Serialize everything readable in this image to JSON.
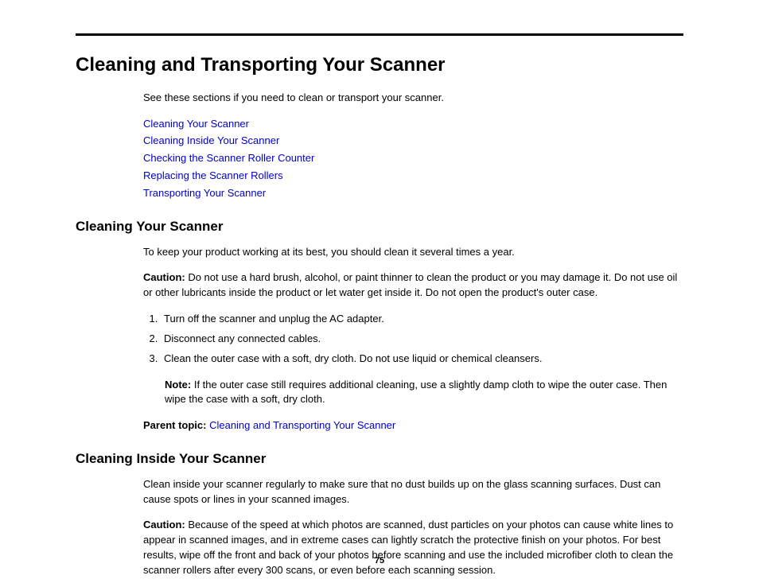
{
  "heading": "Cleaning and Transporting Your Scanner",
  "intro": "See these sections if you need to clean or transport your scanner.",
  "links": [
    "Cleaning Your Scanner",
    "Cleaning Inside Your Scanner",
    "Checking the Scanner Roller Counter",
    "Replacing the Scanner Rollers",
    "Transporting Your Scanner"
  ],
  "section1": {
    "title": "Cleaning Your Scanner",
    "intro": "To keep your product working at its best, you should clean it several times a year.",
    "caution_label": "Caution:",
    "caution_text": " Do not use a hard brush, alcohol, or paint thinner to clean the product or you may damage it. Do not use oil or other lubricants inside the product or let water get inside it. Do not open the product's outer case.",
    "steps": [
      "Turn off the scanner and unplug the AC adapter.",
      "Disconnect any connected cables.",
      "Clean the outer case with a soft, dry cloth. Do not use liquid or chemical cleansers."
    ],
    "note_label": "Note:",
    "note_text": " If the outer case still requires additional cleaning, use a slightly damp cloth to wipe the outer case. Then wipe the case with a soft, dry cloth.",
    "parent_label": "Parent topic:",
    "parent_link": " Cleaning and Transporting Your Scanner"
  },
  "section2": {
    "title": "Cleaning Inside Your Scanner",
    "intro": "Clean inside your scanner regularly to make sure that no dust builds up on the glass scanning surfaces. Dust can cause spots or lines in your scanned images.",
    "caution_label": "Caution:",
    "caution_text": " Because of the speed at which photos are scanned, dust particles on your photos can cause white lines to appear in scanned images, and in extreme cases can lightly scratch the protective finish on your photos. For best results, wipe off the front and back of your photos before scanning and use the included microfiber cloth to clean the scanner rollers after every 300 scans, or even before each scanning session."
  },
  "page_number": "75"
}
